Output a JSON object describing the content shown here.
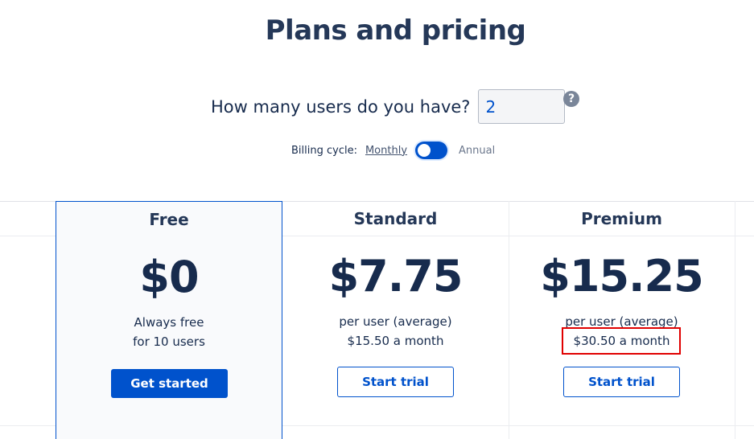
{
  "header": {
    "title": "Plans and pricing"
  },
  "users": {
    "label": "How many users do you have?",
    "value": "2",
    "help_icon": "question-mark-circle-icon"
  },
  "billing": {
    "label": "Billing cycle:",
    "monthly": "Monthly",
    "annual": "Annual",
    "selected": "Monthly"
  },
  "plans": [
    {
      "name": "Free",
      "price": "$0",
      "line1": "Always free",
      "line2": "for 10 users",
      "button": "Get started"
    },
    {
      "name": "Standard",
      "price": "$7.75",
      "line1": "per user (average)",
      "line2": "$15.50 a month",
      "button": "Start trial"
    },
    {
      "name": "Premium",
      "price": "$15.25",
      "line1": "per user (average)",
      "line2": "$30.50 a month",
      "button": "Start trial"
    }
  ],
  "colors": {
    "accent": "#0052cc",
    "text": "#172b4d",
    "highlight": "#e00000"
  }
}
